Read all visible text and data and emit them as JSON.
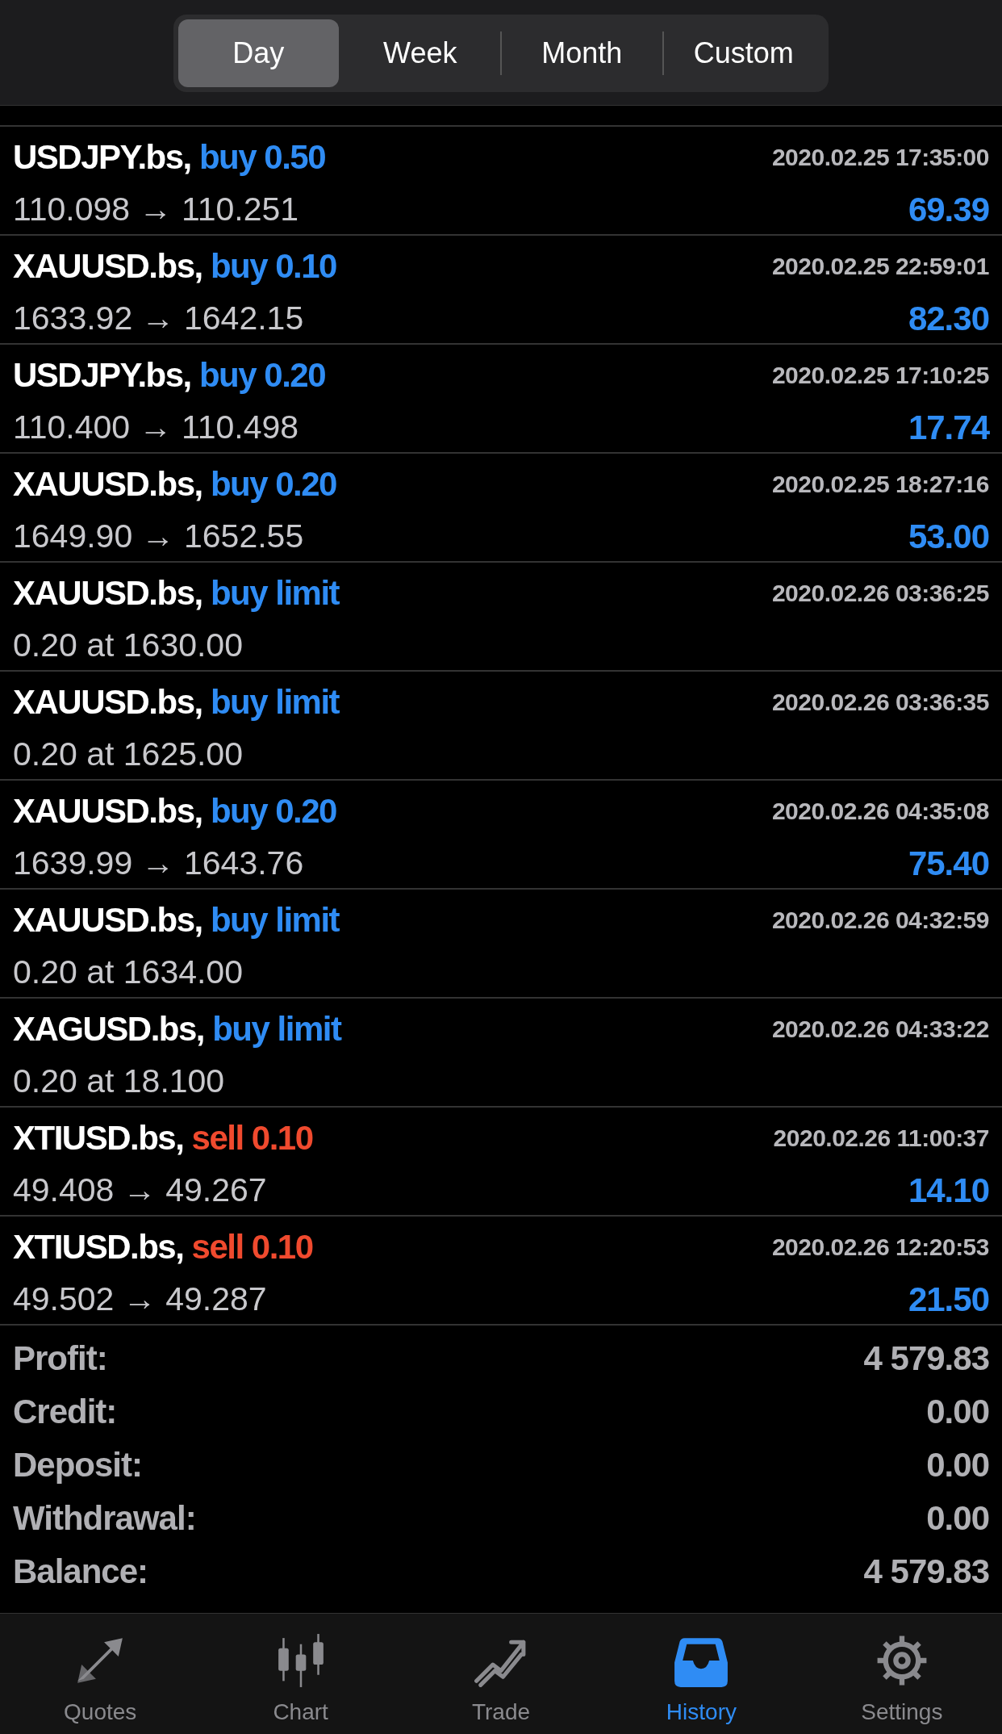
{
  "segments": [
    {
      "label": "Day",
      "selected": true
    },
    {
      "label": "Week",
      "selected": false
    },
    {
      "label": "Month",
      "selected": false
    },
    {
      "label": "Custom",
      "selected": false
    }
  ],
  "history": [
    {
      "kind": "deal",
      "symbol": "USDJPY.bs,",
      "action": "buy 0.50",
      "sell": false,
      "time": "2020.02.25 17:35:00",
      "detail": "110.098 → 110.251",
      "profit": "69.39"
    },
    {
      "kind": "deal",
      "symbol": "XAUUSD.bs,",
      "action": "buy 0.10",
      "sell": false,
      "time": "2020.02.25 22:59:01",
      "detail": "1633.92 → 1642.15",
      "profit": "82.30"
    },
    {
      "kind": "deal",
      "symbol": "USDJPY.bs,",
      "action": "buy 0.20",
      "sell": false,
      "time": "2020.02.25 17:10:25",
      "detail": "110.400 → 110.498",
      "profit": "17.74"
    },
    {
      "kind": "deal",
      "symbol": "XAUUSD.bs,",
      "action": "buy 0.20",
      "sell": false,
      "time": "2020.02.25 18:27:16",
      "detail": "1649.90 → 1652.55",
      "profit": "53.00"
    },
    {
      "kind": "order",
      "symbol": "XAUUSD.bs,",
      "action": "buy limit",
      "sell": false,
      "time": "2020.02.26 03:36:25",
      "detail": "0.20 at 1630.00"
    },
    {
      "kind": "order",
      "symbol": "XAUUSD.bs,",
      "action": "buy limit",
      "sell": false,
      "time": "2020.02.26 03:36:35",
      "detail": "0.20 at 1625.00"
    },
    {
      "kind": "deal",
      "symbol": "XAUUSD.bs,",
      "action": "buy 0.20",
      "sell": false,
      "time": "2020.02.26 04:35:08",
      "detail": "1639.99 → 1643.76",
      "profit": "75.40"
    },
    {
      "kind": "order",
      "symbol": "XAUUSD.bs,",
      "action": "buy limit",
      "sell": false,
      "time": "2020.02.26 04:32:59",
      "detail": "0.20 at 1634.00"
    },
    {
      "kind": "order",
      "symbol": "XAGUSD.bs,",
      "action": "buy limit",
      "sell": false,
      "time": "2020.02.26 04:33:22",
      "detail": "0.20 at 18.100"
    },
    {
      "kind": "deal",
      "symbol": "XTIUSD.bs,",
      "action": "sell 0.10",
      "sell": true,
      "time": "2020.02.26 11:00:37",
      "detail": "49.408 → 49.267",
      "profit": "14.10"
    },
    {
      "kind": "deal",
      "symbol": "XTIUSD.bs,",
      "action": "sell 0.10",
      "sell": true,
      "time": "2020.02.26 12:20:53",
      "detail": "49.502 → 49.287",
      "profit": "21.50"
    }
  ],
  "summary": [
    {
      "label": "Profit:",
      "value": "4 579.83"
    },
    {
      "label": "Credit:",
      "value": "0.00"
    },
    {
      "label": "Deposit:",
      "value": "0.00"
    },
    {
      "label": "Withdrawal:",
      "value": "0.00"
    },
    {
      "label": "Balance:",
      "value": "4 579.83"
    }
  ],
  "tab_bar": [
    {
      "kind": "quotes",
      "label": "Quotes",
      "selected": false
    },
    {
      "kind": "chart",
      "label": "Chart",
      "selected": false
    },
    {
      "kind": "trade",
      "label": "Trade",
      "selected": false
    },
    {
      "kind": "history",
      "label": "History",
      "selected": true
    },
    {
      "kind": "settings",
      "label": "Settings",
      "selected": false
    }
  ]
}
